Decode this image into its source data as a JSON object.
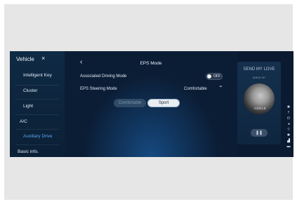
{
  "sidebar": {
    "title": "Vehicle",
    "close_icon": "close-icon",
    "items": [
      {
        "label": "Intelligent Key"
      },
      {
        "label": "Cluster"
      },
      {
        "label": "Light"
      },
      {
        "label": "A/C"
      },
      {
        "label": "Auxiliary Drive"
      },
      {
        "label": "Basic info."
      }
    ]
  },
  "main": {
    "back_icon": "chevron-left-icon",
    "title": "EPS Mode",
    "rows": [
      {
        "label": "Associated Driving Mode"
      },
      {
        "label": "EPS Steering Mode"
      }
    ],
    "toggle": {
      "state": "OFF"
    },
    "steering_value": "Comfortable",
    "buttons": [
      {
        "label": "Comfortable",
        "selected": false
      },
      {
        "label": "Sport",
        "selected": true
      }
    ]
  },
  "media": {
    "song": "SEND MY LOVE",
    "artist": "ADELE·347",
    "cover_text": "ADELE",
    "pause_icon": "pause-icon"
  },
  "status": {
    "icons": [
      "bluetooth-icon",
      "usb-icon",
      "power-icon",
      "volume-icon",
      "wifi-icon",
      "bluetooth-icon",
      "signal-icon",
      "battery-icon"
    ]
  },
  "colors": {
    "background": "#0a1a30",
    "accent": "#5aa8ef"
  }
}
